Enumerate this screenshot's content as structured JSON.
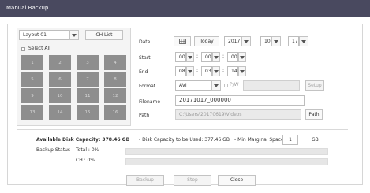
{
  "window": {
    "title": "Manual Backup"
  },
  "left": {
    "layout_value": "Layout 01",
    "ch_list_label": "CH List",
    "select_all_label": "Select All",
    "channels": [
      "1",
      "2",
      "3",
      "4",
      "5",
      "6",
      "7",
      "8",
      "9",
      "10",
      "11",
      "12",
      "13",
      "14",
      "15",
      "16"
    ]
  },
  "right": {
    "date_label": "Date",
    "today_label": "Today",
    "year": "2017",
    "month": "10",
    "day": "17",
    "start_label": "Start",
    "start": [
      "00",
      "00",
      "00"
    ],
    "end_label": "End",
    "end": [
      "08",
      "03",
      "14"
    ],
    "time_sep": ":",
    "format_label": "Format",
    "format_value": "AVI",
    "pw_label": "P/W",
    "setup_label": "Setup",
    "filename_label": "Filename",
    "filename_value": "20171017_000000",
    "path_label": "Path",
    "path_value": "C:\\Users\\20170619\\Videos",
    "path_button": "Path"
  },
  "bottom": {
    "available": "Available Disk Capacity: 378.46 GB",
    "to_be_used": "- Disk Capacity to be Used: 377.46 GB",
    "min_margin_label": "- Min Marginal Space:",
    "min_margin_value": "1",
    "min_margin_unit": "GB",
    "backup_status_label": "Backup Status",
    "total_label": "Total : 0%",
    "total_progress": 0,
    "ch_label": "CH : 0%",
    "ch_progress": 0
  },
  "buttons": {
    "backup": "Backup",
    "stop": "Stop",
    "close": "Close"
  }
}
